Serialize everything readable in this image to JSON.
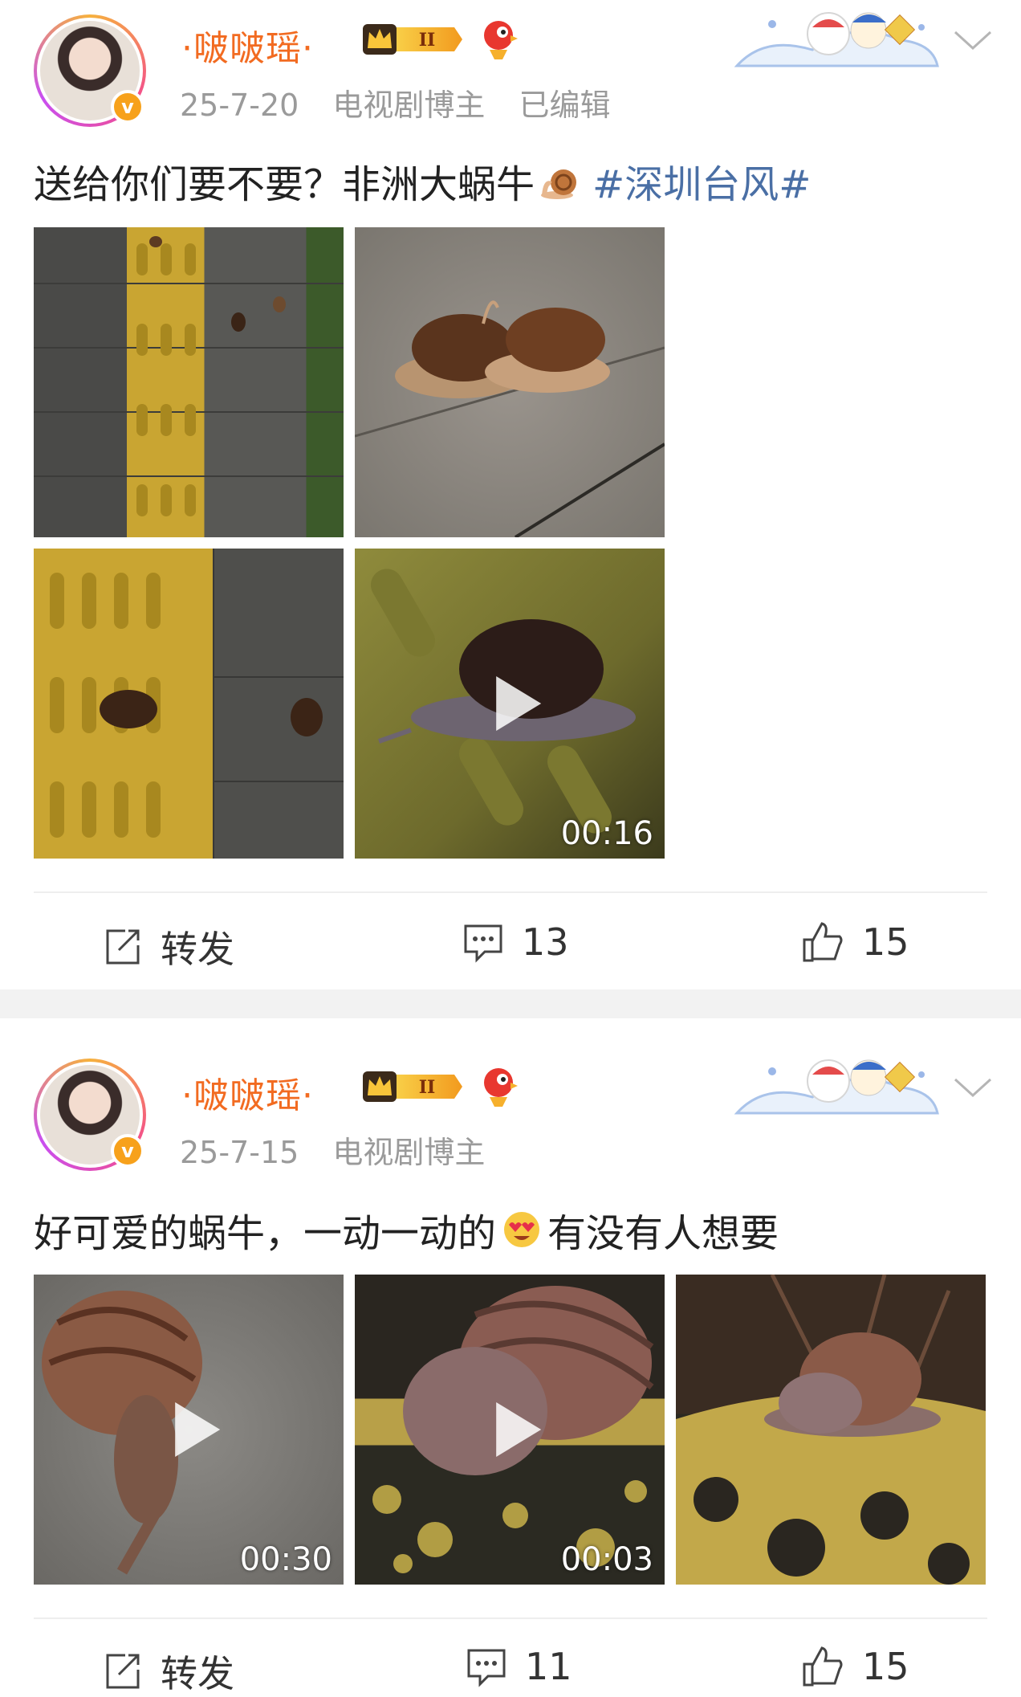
{
  "posts": [
    {
      "user": {
        "name": "·啵啵瑶·",
        "verified_badge": "v"
      },
      "meta": {
        "date": "25-7-20",
        "role": "电视剧博主",
        "edited": "已编辑"
      },
      "text": "送给你们要不要？非洲大蜗牛",
      "hashtag": "#深圳台风#",
      "images": [
        {
          "type": "photo",
          "desc_icon": "snail-on-tactile-paving"
        },
        {
          "type": "photo",
          "desc_icon": "two-snails-on-granite"
        },
        {
          "type": "photo",
          "desc_icon": "snails-on-yellow-tiles"
        },
        {
          "type": "video",
          "duration": "00:16"
        }
      ],
      "actions": {
        "repost_label": "转发",
        "comments": "13",
        "likes": "15"
      }
    },
    {
      "user": {
        "name": "·啵啵瑶·",
        "verified_badge": "v"
      },
      "meta": {
        "date": "25-7-15",
        "role": "电视剧博主"
      },
      "text_before": "好可爱的蜗牛，一动一动的",
      "text_after": " 有没有人想要",
      "images": [
        {
          "type": "video",
          "duration": "00:30"
        },
        {
          "type": "video",
          "duration": "00:03"
        },
        {
          "type": "photo",
          "desc_icon": "snail-on-yellow-curb"
        }
      ],
      "actions": {
        "repost_label": "转发",
        "comments": "11",
        "likes": "15"
      }
    }
  ],
  "colors": {
    "name": "#f26b21",
    "hashtag": "#4a6fa5",
    "meta": "#9a9a9a",
    "separator": "#f2f2f2"
  }
}
